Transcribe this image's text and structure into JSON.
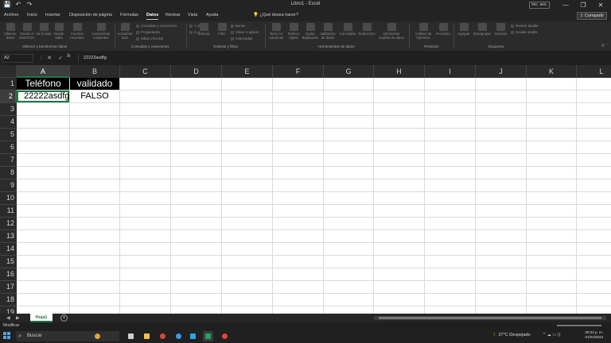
{
  "titlebar": {
    "title": "Libro1 - Excel",
    "signin": "Inic. ses.",
    "qat": {
      "save": "💾",
      "undo": "↶",
      "redo": "↷"
    },
    "window_controls": {
      "minimize": "—",
      "restore": "❐",
      "close": "✕"
    }
  },
  "tabs": {
    "items": [
      "Archivo",
      "Inicio",
      "Insertar",
      "Disposición de página",
      "Fórmulas",
      "Datos",
      "Revisar",
      "Vista",
      "Ayuda"
    ],
    "active": "Datos",
    "tell_me": "¿Qué desea hacer?",
    "share": "Compartir"
  },
  "ribbon": {
    "groups": [
      {
        "label": "Obtener y transformar datos"
      },
      {
        "label": "Consultas y conexiones"
      },
      {
        "label": "Ordenar y filtrar"
      },
      {
        "label": "Herramientas de datos"
      },
      {
        "label": "Previsión"
      },
      {
        "label": "Esquema"
      }
    ],
    "get_data": [
      "Obtener datos",
      "Desde el texto/CSV",
      "De la web",
      "Desde tabla",
      "Fuentes recientes",
      "Conexiones existentes"
    ],
    "queries": [
      "Actualizar todo",
      "Consultas y conexiones",
      "Propiedades",
      "Editar vínculos"
    ],
    "sort": [
      "Ordenar",
      "Filtro",
      "Borrar",
      "Volver a aplicar",
      "Avanzadas"
    ],
    "tools": [
      "Texto en columnas",
      "Relleno rápido",
      "Quitar duplicados",
      "Validación de datos",
      "Consolidar",
      "Relaciones",
      "Administrar modelo de datos"
    ],
    "forecast": [
      "Análisis de hipótesis",
      "Previsión"
    ],
    "outline": [
      "Agrupar",
      "Desagrupar",
      "Subtotal",
      "Mostrar detalle",
      "Ocultar detalle"
    ]
  },
  "formula_bar": {
    "name_box": "A2",
    "fx": "fx",
    "value": "22222asdfg",
    "cancel": "✕",
    "enter": "✓"
  },
  "sheet": {
    "columns": [
      "A",
      "B",
      "C",
      "D",
      "E",
      "F",
      "G",
      "H",
      "I",
      "J",
      "K",
      "L"
    ],
    "rows": [
      "1",
      "2",
      "3",
      "4",
      "5",
      "6",
      "7",
      "8",
      "9",
      "10",
      "11",
      "12",
      "13",
      "14",
      "15",
      "16",
      "17",
      "18",
      "19"
    ],
    "cells": {
      "A1": "Teléfono",
      "B1": "validado",
      "A2": "22222asdfg",
      "B2": "FALSO"
    },
    "selected_cell": "A2"
  },
  "sheet_tabs": {
    "active": "Hoja1",
    "add": "+",
    "prev": "◀",
    "next": "▶"
  },
  "status": {
    "mode": "Modificar"
  },
  "taskbar": {
    "search_placeholder": "Buscar",
    "weather": "27°C  Despejado",
    "time": "09:34 p. m.",
    "date": "01/04/2023",
    "tray_icons": "^ ☁ ▭ ))"
  },
  "colors": {
    "accent": "#217346"
  }
}
